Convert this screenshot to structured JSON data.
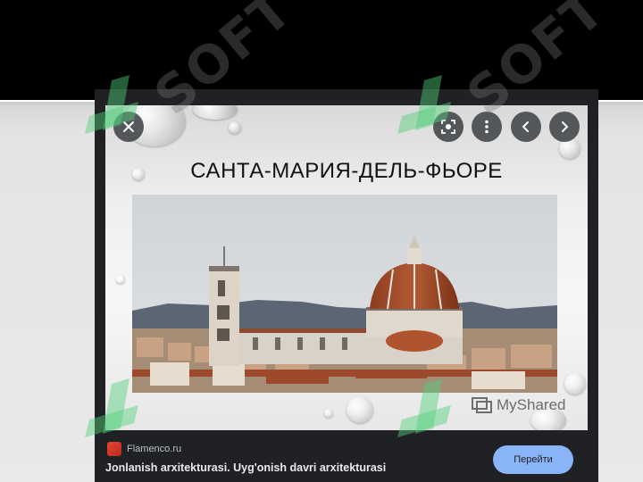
{
  "slide": {
    "title": "САНТА-МАРИЯ-ДЕЛЬ-ФЬОРЕ",
    "brand": "MyShared"
  },
  "controls": {
    "close": "close-icon",
    "lens": "lens-icon",
    "more": "more-vert-icon",
    "prev": "chevron-left-icon",
    "next": "chevron-right-icon"
  },
  "source": {
    "site": "Flamenco.ru"
  },
  "caption": "Jonlanish arxitekturasi. Uyg'onish davri arxitekturasi",
  "action": {
    "go_label": "Перейти"
  },
  "watermark": "SOFT",
  "colors": {
    "accent": "#8ab4f8",
    "panel": "#202124",
    "watermark_green": "#4fd07a"
  }
}
